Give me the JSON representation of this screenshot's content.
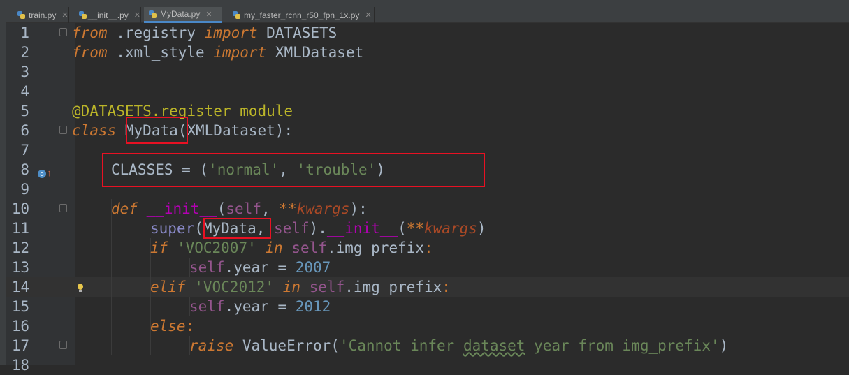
{
  "tabs": [
    {
      "label": "train.py",
      "active": false
    },
    {
      "label": "__init__.py",
      "active": false
    },
    {
      "label": "MyData.py",
      "active": true
    },
    {
      "label": "my_faster_rcnn_r50_fpn_1x.py",
      "active": false
    }
  ],
  "editor": {
    "current_line": 14,
    "lines": [
      {
        "n": "1"
      },
      {
        "n": "2"
      },
      {
        "n": "3"
      },
      {
        "n": "4"
      },
      {
        "n": "5"
      },
      {
        "n": "6"
      },
      {
        "n": "7"
      },
      {
        "n": "8"
      },
      {
        "n": "9"
      },
      {
        "n": "10"
      },
      {
        "n": "11"
      },
      {
        "n": "12"
      },
      {
        "n": "13"
      },
      {
        "n": "14"
      },
      {
        "n": "15"
      },
      {
        "n": "16"
      },
      {
        "n": "17"
      },
      {
        "n": "18"
      }
    ],
    "code": {
      "l1": [
        "from",
        " .registry ",
        "import",
        " DATASETS"
      ],
      "l2": [
        "from",
        " .xml_style ",
        "import",
        " XMLDataset"
      ],
      "l5": "@DATASETS.register_module",
      "l6": [
        "class",
        " ",
        "MyData",
        "(XMLDataset):"
      ],
      "l8": [
        "CLASSES",
        " = (",
        "'normal'",
        ", ",
        "'trouble'",
        ")"
      ],
      "l10": [
        "def",
        " ",
        "__init__",
        "(",
        "self",
        ", ",
        "**",
        "kwargs",
        "):"
      ],
      "l11": [
        "super",
        "(",
        "MyData",
        ", ",
        "self",
        ").",
        "__init__",
        "(",
        "**",
        "kwargs",
        ")"
      ],
      "l12": [
        "if",
        " ",
        "'VOC2007'",
        " ",
        "in",
        " ",
        "self",
        ".img_prefix",
        ":"
      ],
      "l13": [
        "self",
        ".year",
        " = ",
        "2007"
      ],
      "l14": [
        "elif",
        " ",
        "'VOC2012'",
        " ",
        "in",
        " ",
        "self",
        ".img_prefix",
        ":"
      ],
      "l15": [
        "self",
        ".year",
        " = ",
        "2012"
      ],
      "l16": [
        "else",
        ":"
      ],
      "l17": [
        "raise",
        " ValueError(",
        "'Cannot infer ",
        "dataset",
        " year from img_prefix'",
        ")"
      ]
    }
  },
  "colors": {
    "highlight_box": "#e81123",
    "keyword": "#cc7832",
    "string": "#6a8759",
    "number": "#6897bb",
    "decorator": "#bbb529",
    "self": "#94558d"
  },
  "icons": {
    "file_tab": "python-file-icon",
    "override": "override-marker-icon",
    "intention": "lightbulb-icon"
  }
}
